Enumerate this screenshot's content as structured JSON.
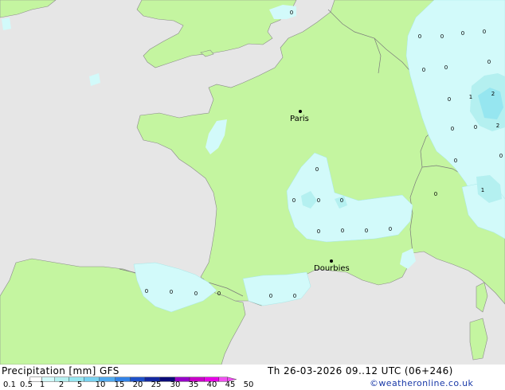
{
  "map": {
    "cities": [
      {
        "name": "Paris"
      },
      {
        "name": "Dourbies"
      }
    ],
    "precip_labels": [
      "0",
      "0",
      "0",
      "0",
      "0",
      "0",
      "0",
      "0",
      "1",
      "2",
      "0",
      "0",
      "2",
      "0",
      "0",
      "1",
      "0",
      "0",
      "0",
      "0",
      "0",
      "0",
      "0",
      "0",
      "0",
      "0",
      "0",
      "0",
      "0",
      "0",
      "0",
      "0"
    ]
  },
  "footer": {
    "title": "Precipitation [mm]  GFS",
    "datetime": "Th 26-03-2026 09..12 UTC (06+246)",
    "credit": "©weatheronline.co.uk"
  },
  "legend": {
    "ticks": [
      "0.1",
      "0.5",
      "1",
      "2",
      "5",
      "10",
      "15",
      "20",
      "25",
      "30",
      "35",
      "40",
      "45",
      "50"
    ],
    "colors": [
      "#ffffff",
      "#d2fafa",
      "#b4f0f0",
      "#96e6f0",
      "#78d2f0",
      "#50aaf0",
      "#3282e6",
      "#1e50c8",
      "#1428a0",
      "#0a0a78",
      "#9600c8",
      "#c800c8",
      "#e600e6",
      "#f050f0"
    ]
  }
}
